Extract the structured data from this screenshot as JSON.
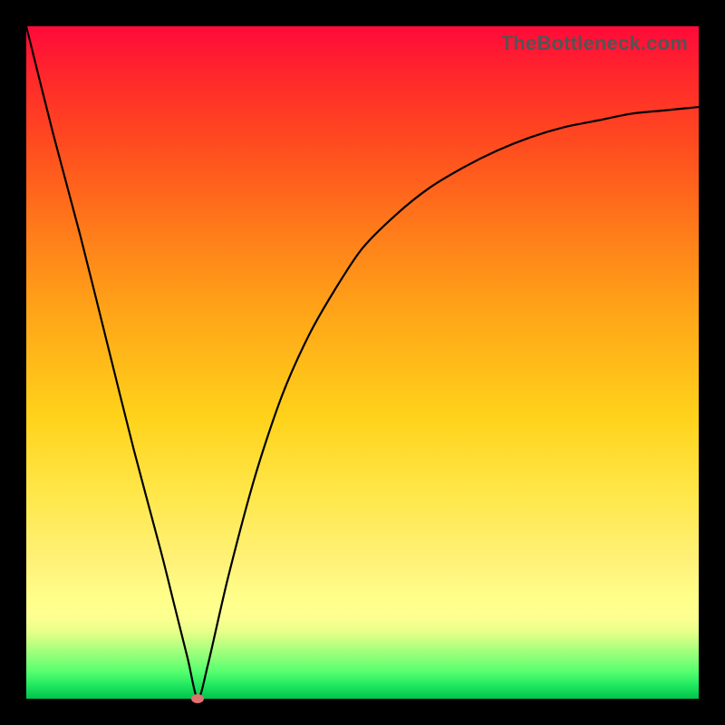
{
  "watermark": "TheBottleneck.com",
  "colors": {
    "frame": "#000000",
    "curve": "#000000",
    "marker": "#e17070",
    "gradient_top": "#ff0a3a",
    "gradient_bottom": "#00c24c"
  },
  "chart_data": {
    "type": "line",
    "title": "",
    "xlabel": "",
    "ylabel": "",
    "xlim": [
      0,
      100
    ],
    "ylim": [
      0,
      100
    ],
    "grid": false,
    "legend_position": "none",
    "series": [
      {
        "name": "bottleneck-curve",
        "x": [
          0,
          4,
          8,
          12,
          16,
          20,
          22,
          24,
          25.5,
          27,
          30,
          34,
          38,
          42,
          46,
          50,
          55,
          60,
          65,
          70,
          75,
          80,
          85,
          90,
          95,
          100
        ],
        "values": [
          100,
          84,
          69,
          53,
          37,
          22,
          14,
          6,
          0,
          5,
          18,
          33,
          45,
          54,
          61,
          67,
          72,
          76,
          79,
          81.5,
          83.5,
          85,
          86,
          87,
          87.5,
          88
        ]
      }
    ],
    "annotations": [
      {
        "name": "optimal-marker",
        "x": 25.5,
        "y": 0
      }
    ]
  }
}
